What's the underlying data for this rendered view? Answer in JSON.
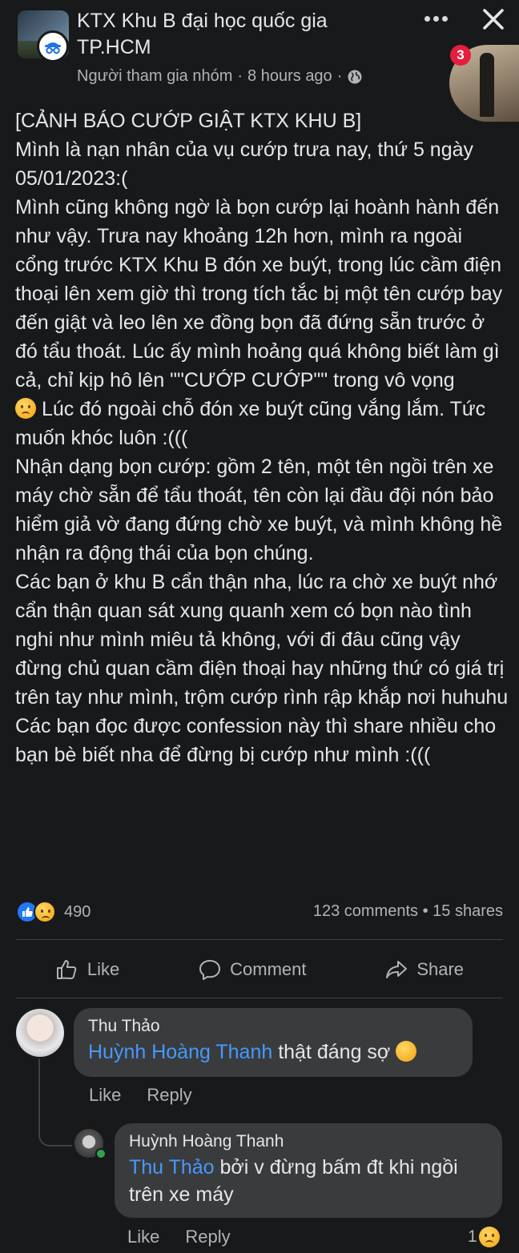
{
  "header": {
    "group_name": "KTX Khu B đại học quốc gia TP.HCM",
    "member_role": "Người tham gia nhóm",
    "time_ago": "8 hours ago",
    "separator": "·",
    "privacy_icon": "globe-icon",
    "notification_count": "3"
  },
  "post": {
    "paragraphs": [
      "[CẢNH BÁO CƯỚP GIẬT KTX KHU B]",
      "Mình là nạn nhân của vụ cướp trưa nay, thứ 5 ngày 05/01/2023:(",
      "Mình cũng không ngờ là bọn cướp lại hoành hành đến như vậy. Trưa nay khoảng 12h hơn, mình ra ngoài cổng trước KTX Khu B đón xe buýt, trong lúc cầm điện thoại lên xem giờ thì trong tích tắc bị một tên cướp bay đến giật và leo lên xe đồng bọn đã đứng sẵn trước ở đó tẩu thoát. Lúc ấy mình hoảng quá không biết làm gì cả, chỉ kịp hô lên \"\"CƯỚP CƯỚP\"\" trong vô vọng",
      "Lúc đó ngoài chỗ đón xe buýt cũng vắng lắm. Tức muốn khóc luôn :(((",
      "Nhận dạng bọn cướp: gồm 2 tên, một tên ngồi trên xe máy chờ sẵn để tẩu thoát, tên còn lại đầu đội nón bảo hiểm giả vờ đang đứng chờ xe buýt, và mình không hề nhận ra động thái của bọn chúng.",
      "Các bạn ở khu B cẩn thận nha, lúc ra chờ xe buýt nhớ cẩn thận quan sát xung quanh xem có bọn nào tình nghi như mình miêu tả không, với đi đâu cũng vậy đừng chủ quan cầm điện thoại hay những thứ có giá trị trên tay như mình, trộm cướp rình rập khắp nơi huhuhu",
      "Các bạn đọc được confession này thì share nhiều cho bạn bè biết nha để đừng bị cướp như mình :((("
    ],
    "reaction_count": "490",
    "comments_count": "123 comments",
    "shares_count": "15 shares",
    "stats_separator": "•"
  },
  "actions": {
    "like": "Like",
    "comment": "Comment",
    "share": "Share"
  },
  "comments": [
    {
      "author": "Thu Thảo",
      "mention": "Huỳnh Hoàng Thanh",
      "text": " thật đáng sợ ",
      "like_label": "Like",
      "reply_label": "Reply"
    },
    {
      "author": "Huỳnh Hoàng Thanh",
      "mention": "Thu Thảo",
      "text": " bởi v đừng bấm đt khi ngồi trên xe máy",
      "like_label": "Like",
      "reply_label": "Reply",
      "reaction_count": "1"
    }
  ],
  "colors": {
    "background": "#18191a",
    "bubble": "#3a3b3c",
    "mention": "#4599ff",
    "badge": "#e41e3f"
  }
}
